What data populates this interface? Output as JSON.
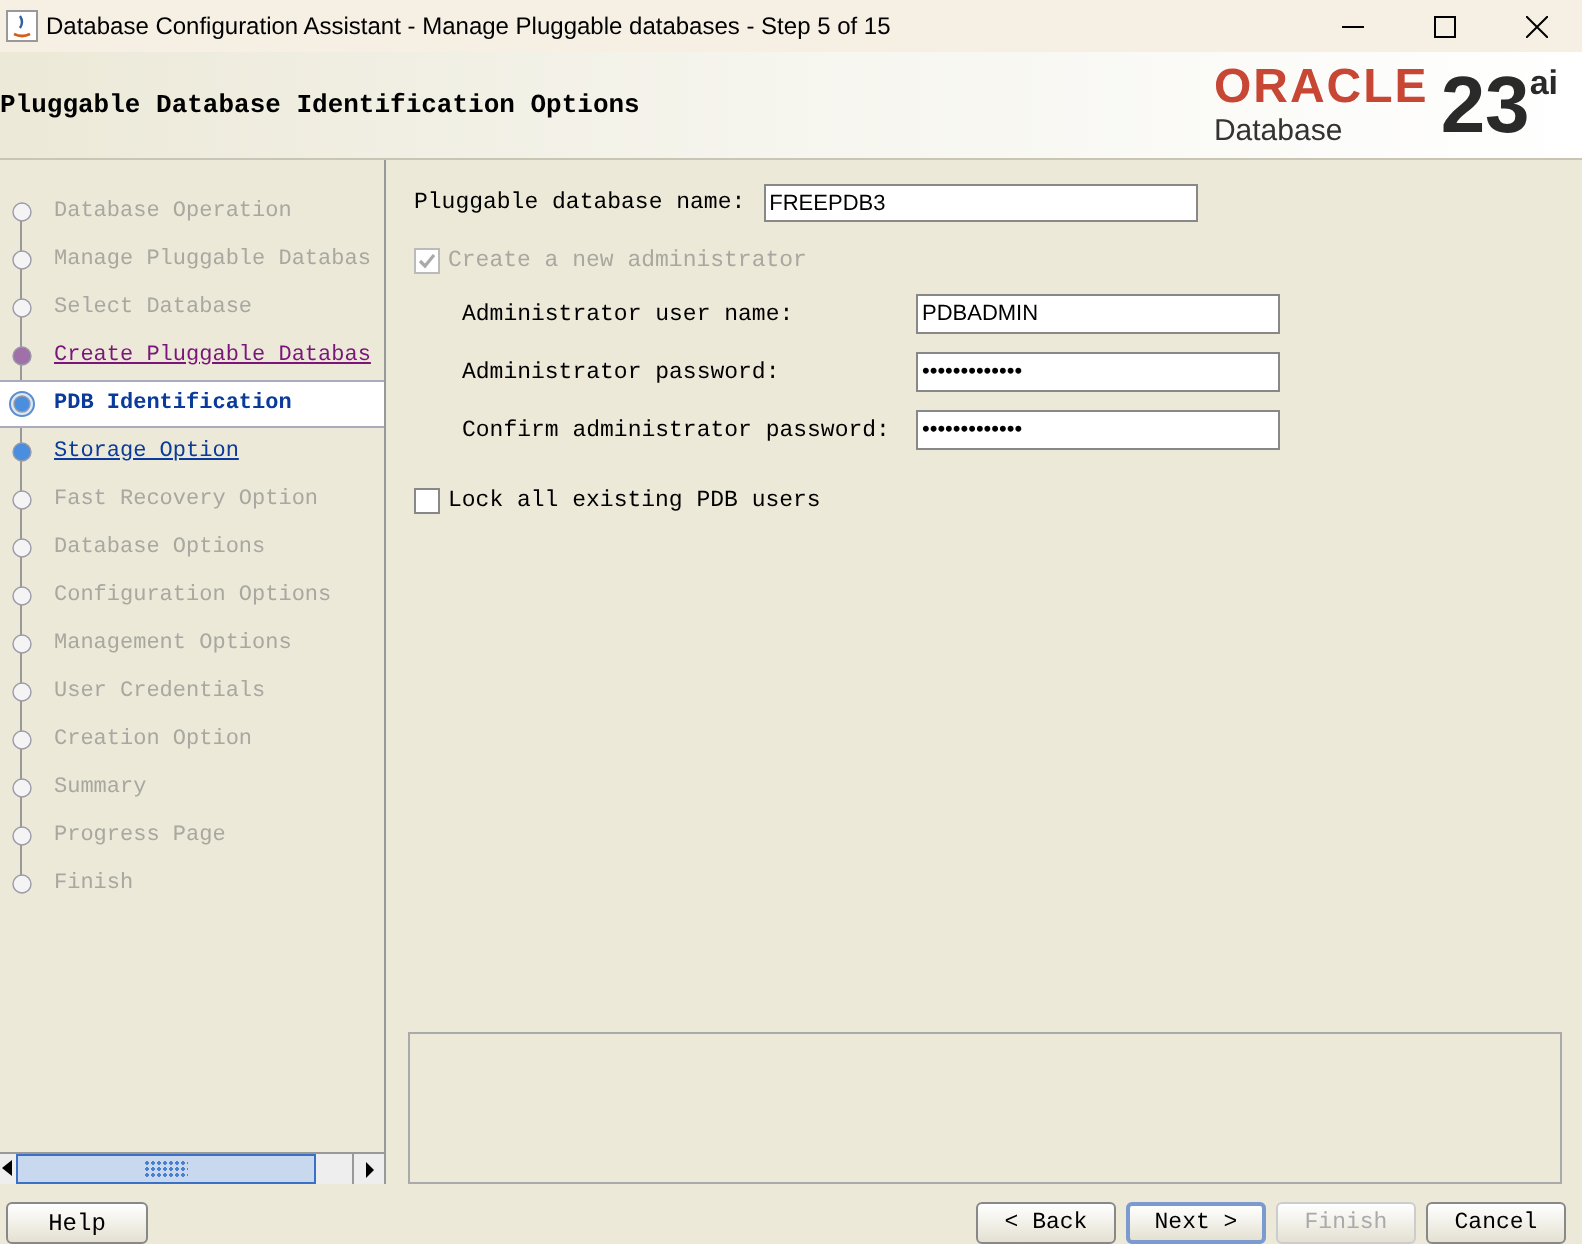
{
  "window": {
    "title": "Database Configuration Assistant - Manage Pluggable databases - Step 5 of 15"
  },
  "header": {
    "title": "Pluggable Database Identification Options",
    "logo": {
      "brand": "ORACLE",
      "product": "Database",
      "version": "23",
      "suffix": "ai"
    }
  },
  "steps": [
    {
      "label": "Database Operation",
      "selected": false,
      "visited": false,
      "disabled": true
    },
    {
      "label": "Manage Pluggable Databas",
      "selected": false,
      "visited": false,
      "disabled": true
    },
    {
      "label": "Select Database",
      "selected": false,
      "visited": false,
      "disabled": true
    },
    {
      "label": "Create Pluggable Databas",
      "selected": false,
      "visited": true,
      "disabled": false
    },
    {
      "label": "PDB Identification",
      "selected": true,
      "visited": false,
      "disabled": false
    },
    {
      "label": "Storage Option",
      "selected": false,
      "visited": false,
      "disabled": false
    },
    {
      "label": "Fast Recovery Option",
      "selected": false,
      "visited": false,
      "disabled": true
    },
    {
      "label": "Database Options",
      "selected": false,
      "visited": false,
      "disabled": true
    },
    {
      "label": "Configuration Options",
      "selected": false,
      "visited": false,
      "disabled": true
    },
    {
      "label": "Management Options",
      "selected": false,
      "visited": false,
      "disabled": true
    },
    {
      "label": "User Credentials",
      "selected": false,
      "visited": false,
      "disabled": true
    },
    {
      "label": "Creation Option",
      "selected": false,
      "visited": false,
      "disabled": true
    },
    {
      "label": "Summary",
      "selected": false,
      "visited": false,
      "disabled": true
    },
    {
      "label": "Progress Page",
      "selected": false,
      "visited": false,
      "disabled": true
    },
    {
      "label": "Finish",
      "selected": false,
      "visited": false,
      "disabled": true
    }
  ],
  "form": {
    "pdb_name": {
      "label": "Pluggable database name:",
      "value": "FREEPDB3"
    },
    "create_admin": {
      "label": "Create a new administrator",
      "checked": true,
      "disabled": true
    },
    "admin_fields": [
      {
        "label": "Administrator user name:",
        "value": "PDBADMIN"
      },
      {
        "label": "Administrator password:",
        "value": "•••••••••••••"
      },
      {
        "label": "Confirm administrator password:",
        "value": "•••••••••••••"
      }
    ],
    "lock_users": {
      "label": "Lock all existing PDB users",
      "checked": false
    }
  },
  "buttons": {
    "help": {
      "label": "Help"
    },
    "nav": [
      {
        "label": "< Back",
        "disabled": false,
        "default": false
      },
      {
        "label": "Next >",
        "disabled": false,
        "default": true
      },
      {
        "label": "Finish",
        "disabled": true,
        "default": false
      },
      {
        "label": "Cancel",
        "disabled": false,
        "default": false
      }
    ]
  }
}
